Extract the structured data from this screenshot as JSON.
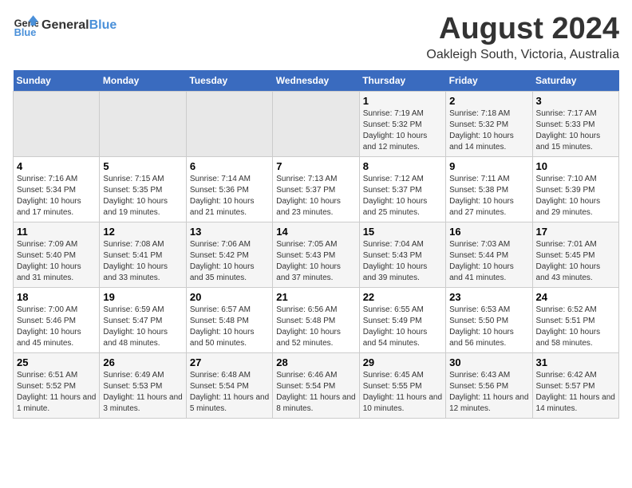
{
  "header": {
    "logo_general": "General",
    "logo_blue": "Blue",
    "month": "August 2024",
    "location": "Oakleigh South, Victoria, Australia"
  },
  "weekdays": [
    "Sunday",
    "Monday",
    "Tuesday",
    "Wednesday",
    "Thursday",
    "Friday",
    "Saturday"
  ],
  "weeks": [
    [
      {
        "day": "",
        "sunrise": "",
        "sunset": "",
        "daylight": ""
      },
      {
        "day": "",
        "sunrise": "",
        "sunset": "",
        "daylight": ""
      },
      {
        "day": "",
        "sunrise": "",
        "sunset": "",
        "daylight": ""
      },
      {
        "day": "",
        "sunrise": "",
        "sunset": "",
        "daylight": ""
      },
      {
        "day": "1",
        "sunrise": "Sunrise: 7:19 AM",
        "sunset": "Sunset: 5:32 PM",
        "daylight": "Daylight: 10 hours and 12 minutes."
      },
      {
        "day": "2",
        "sunrise": "Sunrise: 7:18 AM",
        "sunset": "Sunset: 5:32 PM",
        "daylight": "Daylight: 10 hours and 14 minutes."
      },
      {
        "day": "3",
        "sunrise": "Sunrise: 7:17 AM",
        "sunset": "Sunset: 5:33 PM",
        "daylight": "Daylight: 10 hours and 15 minutes."
      }
    ],
    [
      {
        "day": "4",
        "sunrise": "Sunrise: 7:16 AM",
        "sunset": "Sunset: 5:34 PM",
        "daylight": "Daylight: 10 hours and 17 minutes."
      },
      {
        "day": "5",
        "sunrise": "Sunrise: 7:15 AM",
        "sunset": "Sunset: 5:35 PM",
        "daylight": "Daylight: 10 hours and 19 minutes."
      },
      {
        "day": "6",
        "sunrise": "Sunrise: 7:14 AM",
        "sunset": "Sunset: 5:36 PM",
        "daylight": "Daylight: 10 hours and 21 minutes."
      },
      {
        "day": "7",
        "sunrise": "Sunrise: 7:13 AM",
        "sunset": "Sunset: 5:37 PM",
        "daylight": "Daylight: 10 hours and 23 minutes."
      },
      {
        "day": "8",
        "sunrise": "Sunrise: 7:12 AM",
        "sunset": "Sunset: 5:37 PM",
        "daylight": "Daylight: 10 hours and 25 minutes."
      },
      {
        "day": "9",
        "sunrise": "Sunrise: 7:11 AM",
        "sunset": "Sunset: 5:38 PM",
        "daylight": "Daylight: 10 hours and 27 minutes."
      },
      {
        "day": "10",
        "sunrise": "Sunrise: 7:10 AM",
        "sunset": "Sunset: 5:39 PM",
        "daylight": "Daylight: 10 hours and 29 minutes."
      }
    ],
    [
      {
        "day": "11",
        "sunrise": "Sunrise: 7:09 AM",
        "sunset": "Sunset: 5:40 PM",
        "daylight": "Daylight: 10 hours and 31 minutes."
      },
      {
        "day": "12",
        "sunrise": "Sunrise: 7:08 AM",
        "sunset": "Sunset: 5:41 PM",
        "daylight": "Daylight: 10 hours and 33 minutes."
      },
      {
        "day": "13",
        "sunrise": "Sunrise: 7:06 AM",
        "sunset": "Sunset: 5:42 PM",
        "daylight": "Daylight: 10 hours and 35 minutes."
      },
      {
        "day": "14",
        "sunrise": "Sunrise: 7:05 AM",
        "sunset": "Sunset: 5:43 PM",
        "daylight": "Daylight: 10 hours and 37 minutes."
      },
      {
        "day": "15",
        "sunrise": "Sunrise: 7:04 AM",
        "sunset": "Sunset: 5:43 PM",
        "daylight": "Daylight: 10 hours and 39 minutes."
      },
      {
        "day": "16",
        "sunrise": "Sunrise: 7:03 AM",
        "sunset": "Sunset: 5:44 PM",
        "daylight": "Daylight: 10 hours and 41 minutes."
      },
      {
        "day": "17",
        "sunrise": "Sunrise: 7:01 AM",
        "sunset": "Sunset: 5:45 PM",
        "daylight": "Daylight: 10 hours and 43 minutes."
      }
    ],
    [
      {
        "day": "18",
        "sunrise": "Sunrise: 7:00 AM",
        "sunset": "Sunset: 5:46 PM",
        "daylight": "Daylight: 10 hours and 45 minutes."
      },
      {
        "day": "19",
        "sunrise": "Sunrise: 6:59 AM",
        "sunset": "Sunset: 5:47 PM",
        "daylight": "Daylight: 10 hours and 48 minutes."
      },
      {
        "day": "20",
        "sunrise": "Sunrise: 6:57 AM",
        "sunset": "Sunset: 5:48 PM",
        "daylight": "Daylight: 10 hours and 50 minutes."
      },
      {
        "day": "21",
        "sunrise": "Sunrise: 6:56 AM",
        "sunset": "Sunset: 5:48 PM",
        "daylight": "Daylight: 10 hours and 52 minutes."
      },
      {
        "day": "22",
        "sunrise": "Sunrise: 6:55 AM",
        "sunset": "Sunset: 5:49 PM",
        "daylight": "Daylight: 10 hours and 54 minutes."
      },
      {
        "day": "23",
        "sunrise": "Sunrise: 6:53 AM",
        "sunset": "Sunset: 5:50 PM",
        "daylight": "Daylight: 10 hours and 56 minutes."
      },
      {
        "day": "24",
        "sunrise": "Sunrise: 6:52 AM",
        "sunset": "Sunset: 5:51 PM",
        "daylight": "Daylight: 10 hours and 58 minutes."
      }
    ],
    [
      {
        "day": "25",
        "sunrise": "Sunrise: 6:51 AM",
        "sunset": "Sunset: 5:52 PM",
        "daylight": "Daylight: 11 hours and 1 minute."
      },
      {
        "day": "26",
        "sunrise": "Sunrise: 6:49 AM",
        "sunset": "Sunset: 5:53 PM",
        "daylight": "Daylight: 11 hours and 3 minutes."
      },
      {
        "day": "27",
        "sunrise": "Sunrise: 6:48 AM",
        "sunset": "Sunset: 5:54 PM",
        "daylight": "Daylight: 11 hours and 5 minutes."
      },
      {
        "day": "28",
        "sunrise": "Sunrise: 6:46 AM",
        "sunset": "Sunset: 5:54 PM",
        "daylight": "Daylight: 11 hours and 8 minutes."
      },
      {
        "day": "29",
        "sunrise": "Sunrise: 6:45 AM",
        "sunset": "Sunset: 5:55 PM",
        "daylight": "Daylight: 11 hours and 10 minutes."
      },
      {
        "day": "30",
        "sunrise": "Sunrise: 6:43 AM",
        "sunset": "Sunset: 5:56 PM",
        "daylight": "Daylight: 11 hours and 12 minutes."
      },
      {
        "day": "31",
        "sunrise": "Sunrise: 6:42 AM",
        "sunset": "Sunset: 5:57 PM",
        "daylight": "Daylight: 11 hours and 14 minutes."
      }
    ]
  ]
}
